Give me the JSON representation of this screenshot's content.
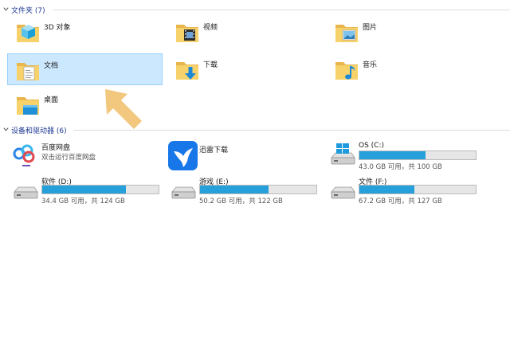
{
  "folders_group": {
    "title": "文件夹 (7)"
  },
  "folders": [
    {
      "label": "3D 对象",
      "icon": "3d-objects-folder-icon"
    },
    {
      "label": "视频",
      "icon": "videos-folder-icon"
    },
    {
      "label": "图片",
      "icon": "pictures-folder-icon"
    },
    {
      "label": "文档",
      "icon": "documents-folder-icon"
    },
    {
      "label": "下载",
      "icon": "downloads-folder-icon"
    },
    {
      "label": "音乐",
      "icon": "music-folder-icon"
    },
    {
      "label": "桌面",
      "icon": "desktop-folder-icon"
    }
  ],
  "devices_group": {
    "title": "设备和驱动器 (6)"
  },
  "apps": [
    {
      "name": "百度网盘",
      "sub": "双击运行百度网盘",
      "icon": "baidu-netdisk-icon"
    },
    {
      "name": "迅雷下载",
      "sub": "",
      "icon": "xunlei-download-icon"
    }
  ],
  "drives": [
    {
      "name": "OS (C:)",
      "capacity": "43.0 GB 可用，共 100 GB",
      "used_fraction": 0.57,
      "icon": "windows-drive-icon"
    },
    {
      "name": "软件 (D:)",
      "capacity": "34.4 GB 可用，共 124 GB",
      "used_fraction": 0.72,
      "icon": "hard-drive-icon"
    },
    {
      "name": "游戏 (E:)",
      "capacity": "50.2 GB 可用，共 122 GB",
      "used_fraction": 0.59,
      "icon": "hard-drive-icon"
    },
    {
      "name": "文件 (F:)",
      "capacity": "67.2 GB 可用，共 127 GB",
      "used_fraction": 0.47,
      "icon": "hard-drive-icon"
    }
  ],
  "colors": {
    "selection_bg": "#cce8ff",
    "selection_border": "#99d1ff",
    "bar_fill": "#26a0da",
    "header_text": "#1f3a93",
    "arrow": "#f2c77e"
  },
  "pointer": "pointing-arrow-icon"
}
